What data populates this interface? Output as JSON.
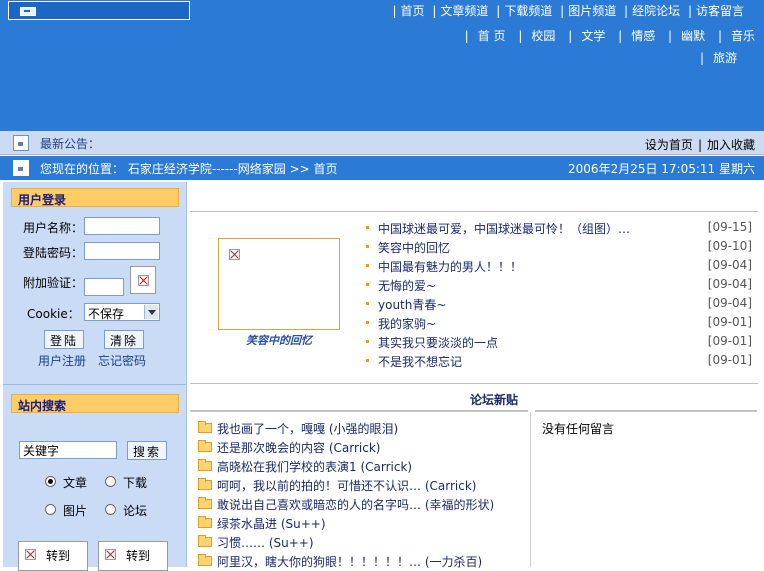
{
  "top_nav": [
    "首页",
    "文章频道",
    "下载频道",
    "图片频道",
    "经院论坛",
    "访客留言"
  ],
  "sub_nav_row1": [
    "首 页",
    "校园",
    "文学",
    "情感",
    "幽默",
    "音乐"
  ],
  "sub_nav_row2": [
    "旅游"
  ],
  "notice": {
    "label": "最新公告：",
    "set_home": "设为首页",
    "add_fav": "加入收藏"
  },
  "location": {
    "text": "您现在的位置： 石家庄经济学院------网络家园 >> 首页",
    "datetime": "2006年2月25日  17:05:11 星期六"
  },
  "login": {
    "title": "用户登录",
    "username_label": "用户名称：",
    "password_label": "登陆密码：",
    "verify_label": "附加验证：",
    "cookie_label": "Cookie：",
    "cookie_value": "不保存",
    "login_button": "登陆",
    "clear_button": "清除",
    "register_link": "用户注册",
    "forgot_link": "忘记密码"
  },
  "search": {
    "title": "站内搜索",
    "placeholder": "关键字",
    "button": "搜索",
    "options": [
      "文章",
      "下载",
      "图片",
      "论坛"
    ],
    "selected": "文章",
    "goto_left": "转到",
    "goto_right": "转到"
  },
  "featured": {
    "caption": "笑容中的回忆"
  },
  "articles": [
    {
      "title": "中国球迷最可爱，中国球迷最可怜！（组图）…",
      "date": "[09-15]"
    },
    {
      "title": "笑容中的回忆",
      "date": "[09-10]"
    },
    {
      "title": "中国最有魅力的男人！！！",
      "date": "[09-04]"
    },
    {
      "title": "无悔的爱~",
      "date": "[09-04]"
    },
    {
      "title": "youth青春~",
      "date": "[09-04]"
    },
    {
      "title": "我的家驹~",
      "date": "[09-01]"
    },
    {
      "title": "其实我只要淡淡的一点",
      "date": "[09-01]"
    },
    {
      "title": "不是我不想忘记",
      "date": "[09-01]"
    }
  ],
  "forum": {
    "title": "论坛新贴",
    "posts": [
      "我也画了一个，嘎嘎  (小强的眼泪)",
      "还是那次晚会的内容  (Carrick)",
      "高晓松在我们学校的表演1  (Carrick)",
      "呵呵，我以前的拍的！可惜还不认识…  (Carrick)",
      "敢说出自己喜欢或暗恋的人的名字吗…  (幸福的形状)",
      "绿茶水晶进  (Su++)",
      "习惯……  (Su++)",
      "阿里汉，瞎大你的狗眼！！！！！！…  (一力杀百)"
    ],
    "no_messages": "没有任何留言"
  }
}
